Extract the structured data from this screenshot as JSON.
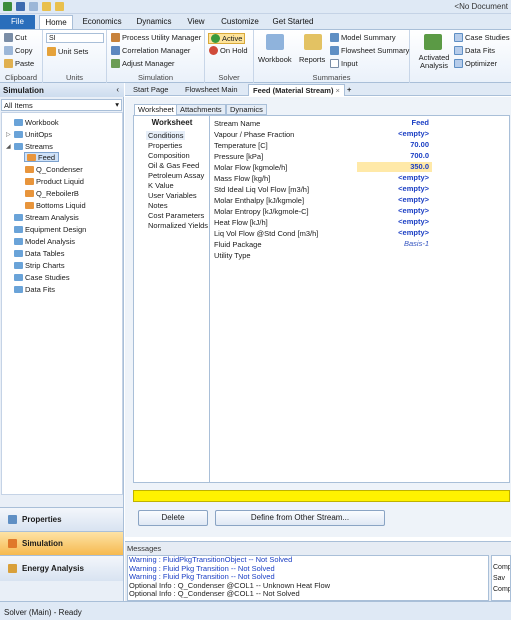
{
  "window": {
    "title": "<No Document"
  },
  "ribbon_tabs": [
    "File",
    "Home",
    "Economics",
    "Dynamics",
    "View",
    "Customize",
    "Get Started"
  ],
  "ribbon": {
    "clipboard": {
      "cut": "Cut",
      "copy": "Copy",
      "paste": "Paste",
      "label": "Clipboard"
    },
    "units": {
      "unit_value": "SI",
      "unit_sets": "Unit Sets",
      "label": "Units"
    },
    "simulation": {
      "process_utility": "Process Utility Manager",
      "correlation": "Correlation Manager",
      "adjust": "Adjust Manager",
      "label": "Simulation"
    },
    "solver": {
      "active": "Active",
      "on_hold": "On Hold",
      "label": "Solver"
    },
    "summaries": {
      "workbook": "Workbook",
      "reports": "Reports",
      "model_summary": "Model Summary",
      "flowsheet_summary": "Flowsheet Summary",
      "input": "Input",
      "label": "Summaries"
    },
    "activated_analysis": "Activated Analysis",
    "analysis": {
      "case_studies": "Case Studies",
      "data_fits": "Data Fits",
      "optimizer": "Optimizer"
    }
  },
  "nav": {
    "header": "Simulation",
    "filter": "All Items",
    "tree": [
      "Workbook",
      "UnitOps",
      "Streams",
      "Feed",
      "Q_Condenser",
      "Product Liquid",
      "Q_ReboilerB",
      "Bottoms Liquid",
      "Stream Analysis",
      "Equipment Design",
      "Model Analysis",
      "Data Tables",
      "Strip Charts",
      "Case Studies",
      "Data Fits"
    ],
    "properties": "Properties",
    "simulation": "Simulation",
    "energy": "Energy Analysis"
  },
  "doc_tabs": [
    "Start Page",
    "Flowsheet Main",
    "Feed (Material Stream)"
  ],
  "sheet_tabs": [
    "Worksheet",
    "Attachments",
    "Dynamics"
  ],
  "worksheet": {
    "title": "Worksheet",
    "sections": [
      "Conditions",
      "Properties",
      "Composition",
      "Oil & Gas Feed",
      "Petroleum Assay",
      "K Value",
      "User Variables",
      "Notes",
      "Cost Parameters",
      "Normalized Yields"
    ],
    "rows": [
      {
        "label": "Stream Name",
        "value": "Feed"
      },
      {
        "label": "Vapour / Phase Fraction",
        "value": "<empty>"
      },
      {
        "label": "Temperature [C]",
        "value": "70.00"
      },
      {
        "label": "Pressure [kPa]",
        "value": "700.0"
      },
      {
        "label": "Molar Flow [kgmole/h]",
        "value": "350.0"
      },
      {
        "label": "Mass Flow [kg/h]",
        "value": "<empty>"
      },
      {
        "label": "Std Ideal Liq Vol Flow [m3/h]",
        "value": "<empty>"
      },
      {
        "label": "Molar Enthalpy [kJ/kgmole]",
        "value": "<empty>"
      },
      {
        "label": "Molar Entropy [kJ/kgmole-C]",
        "value": "<empty>"
      },
      {
        "label": "Heat Flow [kJ/h]",
        "value": "<empty>"
      },
      {
        "label": "Liq Vol Flow @Std Cond [m3/h]",
        "value": "<empty>"
      },
      {
        "label": "Fluid Package",
        "value": "Basis-1"
      },
      {
        "label": "Utility Type",
        "value": ""
      }
    ]
  },
  "buttons": {
    "delete": "Delete",
    "define": "Define from Other Stream..."
  },
  "messages": {
    "title": "Messages",
    "items": [
      "Warning : FluidPkgTransitionObject -- Not Solved",
      "Warning : Fluid Pkg Transition -- Not Solved",
      "Warning : Fluid Pkg Transition -- Not Solved",
      "Optional Info : Q_Condenser @COL1 -- Unknown Heat Flow",
      "Optional Info : Q_Condenser @COL1 -- Not Solved"
    ],
    "side": [
      "Comp",
      "Sav",
      "Comp"
    ]
  },
  "status": "Solver (Main) - Ready"
}
